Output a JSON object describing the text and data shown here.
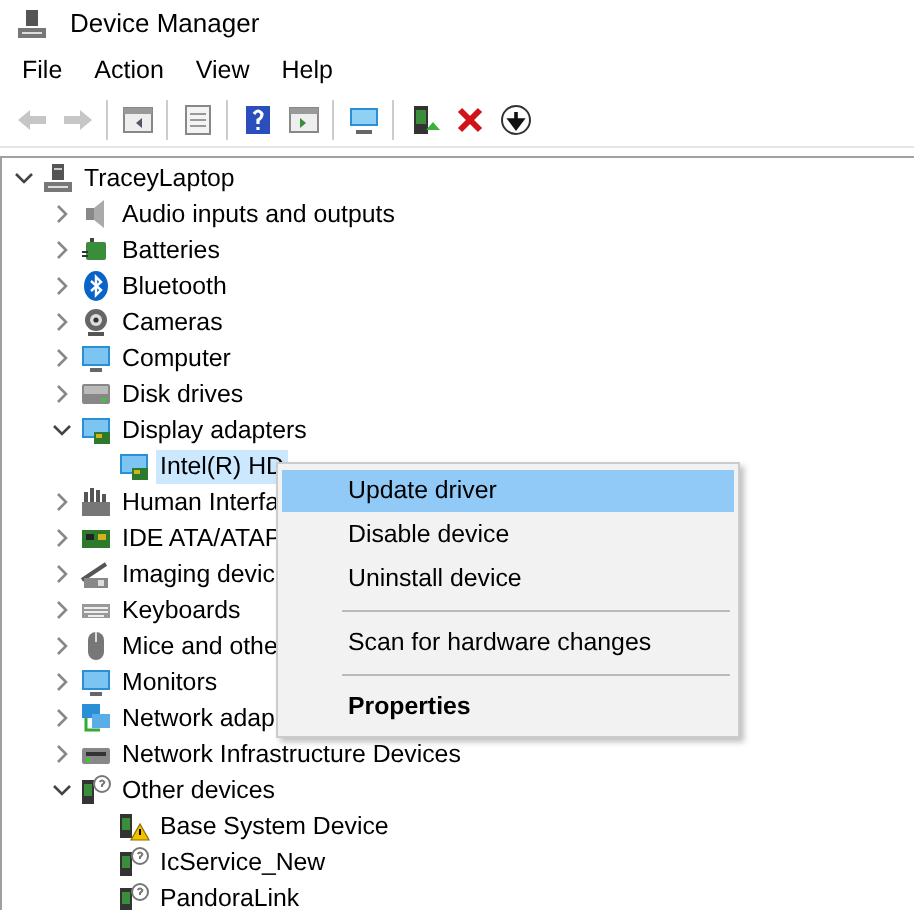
{
  "window": {
    "title": "Device Manager"
  },
  "menu": [
    "File",
    "Action",
    "View",
    "Help"
  ],
  "toolbar": [
    {
      "kind": "back",
      "disabled": true
    },
    {
      "kind": "forward",
      "disabled": true
    },
    {
      "kind": "separator"
    },
    {
      "kind": "tree",
      "disabled": false
    },
    {
      "kind": "separator"
    },
    {
      "kind": "properties",
      "disabled": false
    },
    {
      "kind": "separator"
    },
    {
      "kind": "help",
      "disabled": false
    },
    {
      "kind": "pane",
      "disabled": false
    },
    {
      "kind": "separator"
    },
    {
      "kind": "scan",
      "disabled": false
    },
    {
      "kind": "separator"
    },
    {
      "kind": "driver",
      "disabled": false
    },
    {
      "kind": "uninstall",
      "disabled": false
    },
    {
      "kind": "download",
      "disabled": false
    }
  ],
  "tree": [
    {
      "label": "TraceyLaptop",
      "kind": "computer",
      "expanded": true,
      "selected": false,
      "children": [
        {
          "label": "Audio inputs and outputs",
          "kind": "audio",
          "expanded": false,
          "selected": false
        },
        {
          "label": "Batteries",
          "kind": "battery",
          "expanded": false,
          "selected": false
        },
        {
          "label": "Bluetooth",
          "kind": "bluetooth",
          "expanded": false,
          "selected": false
        },
        {
          "label": "Cameras",
          "kind": "camera",
          "expanded": false,
          "selected": false
        },
        {
          "label": "Computer",
          "kind": "monitor",
          "expanded": false,
          "selected": false
        },
        {
          "label": "Disk drives",
          "kind": "disk",
          "expanded": false,
          "selected": false
        },
        {
          "label": "Display adapters",
          "kind": "display",
          "expanded": true,
          "selected": false,
          "children": [
            {
              "label": "Intel(R) HD",
              "kind": "display",
              "selected": true
            }
          ]
        },
        {
          "label": "Human Interfa",
          "kind": "hid",
          "expanded": false,
          "selected": false
        },
        {
          "label": "IDE ATA/ATAP",
          "kind": "card",
          "expanded": false,
          "selected": false
        },
        {
          "label": "Imaging devic",
          "kind": "imaging",
          "expanded": false,
          "selected": false
        },
        {
          "label": "Keyboards",
          "kind": "keyboard",
          "expanded": false,
          "selected": false
        },
        {
          "label": "Mice and othe",
          "kind": "mouse",
          "expanded": false,
          "selected": false
        },
        {
          "label": "Monitors",
          "kind": "monitor",
          "expanded": false,
          "selected": false
        },
        {
          "label": "Network adap",
          "kind": "network",
          "expanded": false,
          "selected": false
        },
        {
          "label": "Network Infrastructure Devices",
          "kind": "infra",
          "expanded": false,
          "selected": false
        },
        {
          "label": "Other devices",
          "kind": "unknown",
          "expanded": true,
          "selected": false,
          "children": [
            {
              "label": "Base System Device",
              "kind": "warning",
              "selected": false
            },
            {
              "label": "IcService_New",
              "kind": "unknown",
              "selected": false
            },
            {
              "label": "PandoraLink",
              "kind": "unknown",
              "selected": false
            }
          ]
        }
      ]
    }
  ],
  "context_menu": [
    {
      "kind": "item",
      "label": "Update driver",
      "selected": true,
      "default": false
    },
    {
      "kind": "item",
      "label": "Disable device",
      "selected": false,
      "default": false
    },
    {
      "kind": "item",
      "label": "Uninstall device",
      "selected": false,
      "default": false
    },
    {
      "kind": "separator"
    },
    {
      "kind": "item",
      "label": "Scan for hardware changes",
      "selected": false,
      "default": false
    },
    {
      "kind": "separator"
    },
    {
      "kind": "item",
      "label": "Properties",
      "selected": false,
      "default": true
    }
  ]
}
